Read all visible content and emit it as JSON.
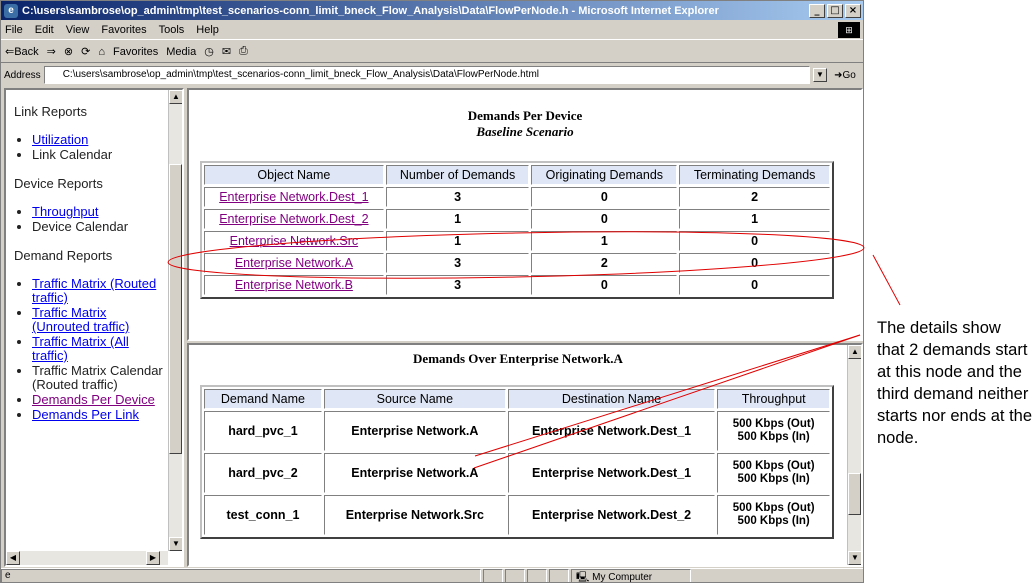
{
  "window": {
    "title": "C:\\users\\sambrose\\op_admin\\tmp\\test_scenarios-conn_limit_bneck_Flow_Analysis\\Data\\FlowPerNode.h - Microsoft Internet Explorer",
    "min_label": "_",
    "max_label": "□",
    "close_label": "×"
  },
  "menu": [
    "File",
    "Edit",
    "View",
    "Favorites",
    "Tools",
    "Help"
  ],
  "toolbar": {
    "back": "⇐Back",
    "forward": "⇒",
    "stop": "⊗",
    "refresh": "⟳",
    "home": "⌂",
    "favorites": "Favorites",
    "media": "Media",
    "history": "◷"
  },
  "address": {
    "label": "Address",
    "value": "C:\\users\\sambrose\\op_admin\\tmp\\test_scenarios-conn_limit_bneck_Flow_Analysis\\Data\\FlowPerNode.html",
    "go": "Go"
  },
  "nav": {
    "link_reports": "Link Reports",
    "utilization": "Utilization",
    "link_calendar": "Link Calendar",
    "device_reports": "Device Reports",
    "throughput": "Throughput",
    "device_calendar": "Device Calendar",
    "demand_reports": "Demand Reports",
    "tm_routed": "Traffic Matrix (Routed traffic)",
    "tm_unrouted": "Traffic Matrix (Unrouted traffic)",
    "tm_all": "Traffic Matrix (All traffic)",
    "tm_calendar": "Traffic Matrix Calendar (Routed traffic)",
    "demands_per_device": "Demands Per Device",
    "demands_per_link": "Demands Per Link"
  },
  "top_report": {
    "title": "Demands Per Device",
    "subtitle": "Baseline Scenario",
    "headers": [
      "Object Name",
      "Number of Demands",
      "Originating Demands",
      "Terminating Demands"
    ],
    "rows": [
      {
        "name": "Enterprise Network.Dest_1",
        "num": "3",
        "orig": "0",
        "term": "2"
      },
      {
        "name": "Enterprise Network.Dest_2",
        "num": "1",
        "orig": "0",
        "term": "1"
      },
      {
        "name": "Enterprise Network.Src",
        "num": "1",
        "orig": "1",
        "term": "0"
      },
      {
        "name": "Enterprise Network.A",
        "num": "3",
        "orig": "2",
        "term": "0"
      },
      {
        "name": "Enterprise Network.B",
        "num": "3",
        "orig": "0",
        "term": "0"
      }
    ]
  },
  "bottom_report": {
    "title": "Demands Over Enterprise Network.A",
    "headers": [
      "Demand Name",
      "Source Name",
      "Destination Name",
      "Throughput"
    ],
    "rows": [
      {
        "demand": "hard_pvc_1",
        "source": "Enterprise Network.A",
        "dest": "Enterprise Network.Dest_1",
        "tp_out": "500 Kbps (Out)",
        "tp_in": "500 Kbps (In)"
      },
      {
        "demand": "hard_pvc_2",
        "source": "Enterprise Network.A",
        "dest": "Enterprise Network.Dest_1",
        "tp_out": "500 Kbps (Out)",
        "tp_in": "500 Kbps (In)"
      },
      {
        "demand": "test_conn_1",
        "source": "Enterprise Network.Src",
        "dest": "Enterprise Network.Dest_2",
        "tp_out": "500 Kbps (Out)",
        "tp_in": "500 Kbps (In)"
      }
    ]
  },
  "status": {
    "zone": "My Computer"
  },
  "callout": {
    "text": "The details show that 2 demands start at this node and the third demand neither starts nor ends at the node."
  },
  "annotation_color": "#e00000"
}
